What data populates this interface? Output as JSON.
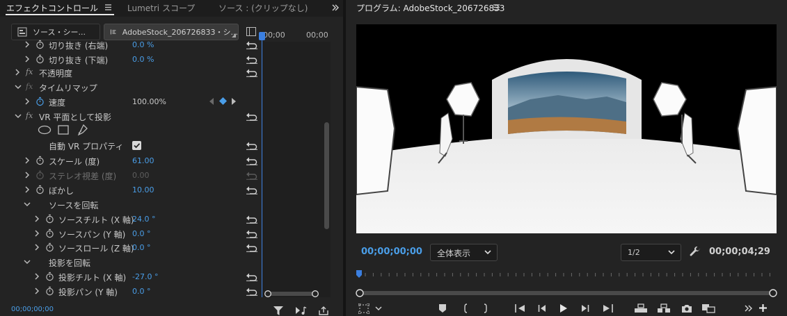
{
  "left_tabs": {
    "effect_controls": "エフェクトコントロール",
    "lumetri_scopes": "Lumetri スコープ",
    "source": "ソース : (クリップなし)"
  },
  "clip_bar": {
    "source": "ソース・シー...",
    "target": "AdobeStock_206726833・シ..."
  },
  "timeline": {
    "tc_left": "00;00",
    "tc_right": "00;00"
  },
  "properties": {
    "crop_right": {
      "label": "切り抜き (右端)",
      "value": "0.0 %"
    },
    "crop_bottom": {
      "label": "切り抜き (下端)",
      "value": "0.0 %"
    },
    "opacity": {
      "label": "不透明度"
    },
    "time_remap": {
      "label": "タイムリマップ"
    },
    "speed": {
      "label": "速度",
      "value": "100.00%"
    },
    "vr_plane": {
      "label": "VR 平面として投影"
    },
    "auto_vr": {
      "label": "自動 VR プロパティ"
    },
    "scale": {
      "label": "スケール (度)",
      "value": "61.00"
    },
    "stereo": {
      "label": "ステレオ視差 (度)",
      "value": "0.00"
    },
    "blur": {
      "label": "ぼかし",
      "value": "10.00"
    },
    "rotate_source": {
      "label": "ソースを回転"
    },
    "src_tilt": {
      "label": "ソースチルト (X 軸)",
      "value": "24.0 °"
    },
    "src_pan": {
      "label": "ソースパン (Y 軸)",
      "value": "0.0 °"
    },
    "src_roll": {
      "label": "ソースロール (Z 軸)",
      "value": "0.0 °"
    },
    "rotate_proj": {
      "label": "投影を回転"
    },
    "proj_tilt": {
      "label": "投影チルト (X 軸)",
      "value": "-27.0 °"
    },
    "proj_pan": {
      "label": "投影パン (Y 軸)",
      "value": "0.0 °"
    }
  },
  "left_footer": {
    "timecode": "00;00;00;00"
  },
  "program": {
    "title": "プログラム: AdobeStock_206726833",
    "current_tc": "00;00;00;00",
    "zoom": "全体表示",
    "quality": "1/2",
    "duration_tc": "00;00;04;29"
  },
  "colors": {
    "accent": "#4a9ee8",
    "panel": "#232323",
    "divider": "#141414"
  }
}
